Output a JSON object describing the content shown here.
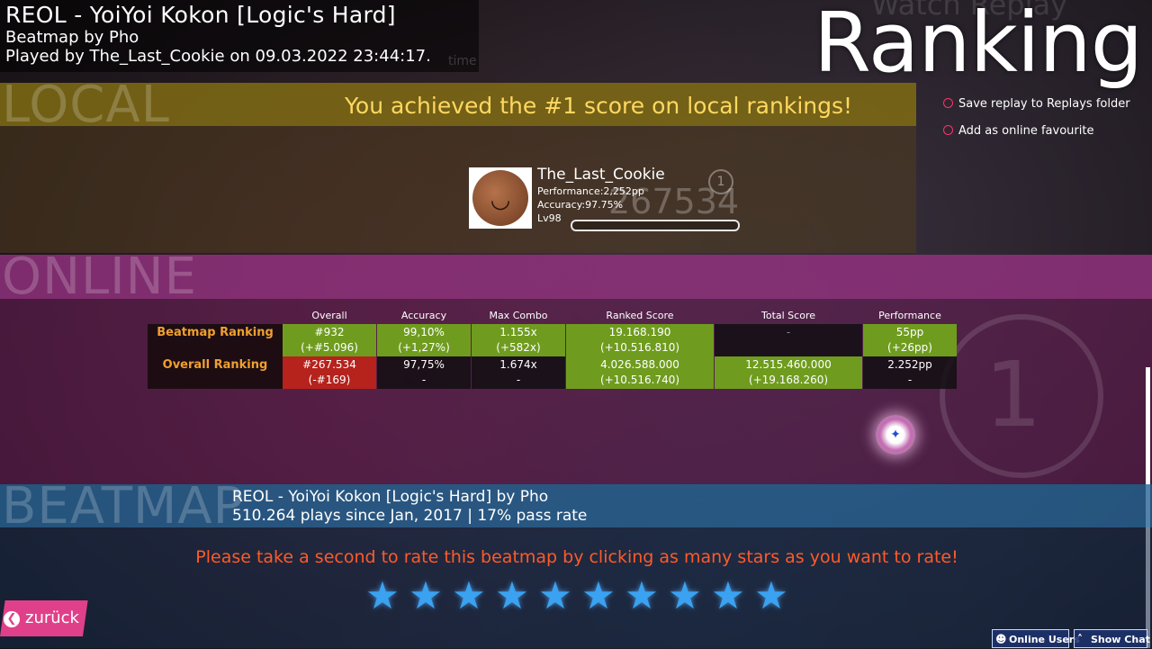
{
  "header": {
    "title": "REOL - YoiYoi Kokon [Logic's Hard]",
    "mapper": "Beatmap by Pho",
    "played_by": "Played by The_Last_Cookie on 09.03.2022 23:44:17.",
    "time_ghost": "time",
    "watch_ghost": "Watch Replay",
    "screen_title": "Ranking"
  },
  "local": {
    "section_label": "LOCAL",
    "message": "You achieved the #1 score on local rankings!",
    "player": {
      "name": "The_Last_Cookie",
      "performance": "Performance:2,252pp",
      "accuracy": "Accuracy:97.75%",
      "level": "Lv98",
      "score_ghost": "267534",
      "rank_badge": "1"
    }
  },
  "options": {
    "save_replay": "Save replay to Replays folder",
    "add_favourite": "Add as online favourite"
  },
  "online": {
    "section_label": "ONLINE",
    "big_rank": "1",
    "columns": [
      "Overall",
      "Accuracy",
      "Max Combo",
      "Ranked Score",
      "Total Score",
      "Performance"
    ],
    "rows": [
      {
        "label": "Beatmap Ranking",
        "overall": [
          "#932",
          "(+#5.096)"
        ],
        "accuracy": [
          "99,10%",
          "(+1,27%)"
        ],
        "max_combo": [
          "1.155x",
          "(+582x)"
        ],
        "ranked_score": [
          "19.168.190",
          "(+10.516.810)"
        ],
        "total_score": [
          "-",
          ""
        ],
        "performance": [
          "55pp",
          "(+26pp)"
        ]
      },
      {
        "label": "Overall Ranking",
        "overall": [
          "#267.534",
          "(-#169)"
        ],
        "accuracy": [
          "97,75%",
          "-"
        ],
        "max_combo": [
          "1.674x",
          "-"
        ],
        "ranked_score": [
          "4.026.588.000",
          "(+10.516.740)"
        ],
        "total_score": [
          "12.515.460.000",
          "(+19.168.260)"
        ],
        "performance": [
          "2.252pp",
          "-"
        ]
      }
    ]
  },
  "beatmap": {
    "section_label": "BEATMAP",
    "title": "REOL - YoiYoi Kokon [Logic's Hard] by Pho",
    "stats": "510.264 plays since Jan, 2017 | 17% pass rate",
    "rate_prompt": "Please take a second to rate this beatmap by clicking as many stars as you want to rate!",
    "star_count": 10,
    "star_glyph": "★"
  },
  "footer": {
    "back": "zurück",
    "online_users": "Online Users",
    "show_chat": "Show Chat"
  },
  "colors": {
    "local_message": "#ffd860",
    "row_label": "#f0a030",
    "green_cell": "#6f9c1e",
    "red_cell": "#b6221c",
    "rate_prompt": "#ff5a2a",
    "star": "#3aa2f0",
    "back_button": "#e0408a"
  }
}
